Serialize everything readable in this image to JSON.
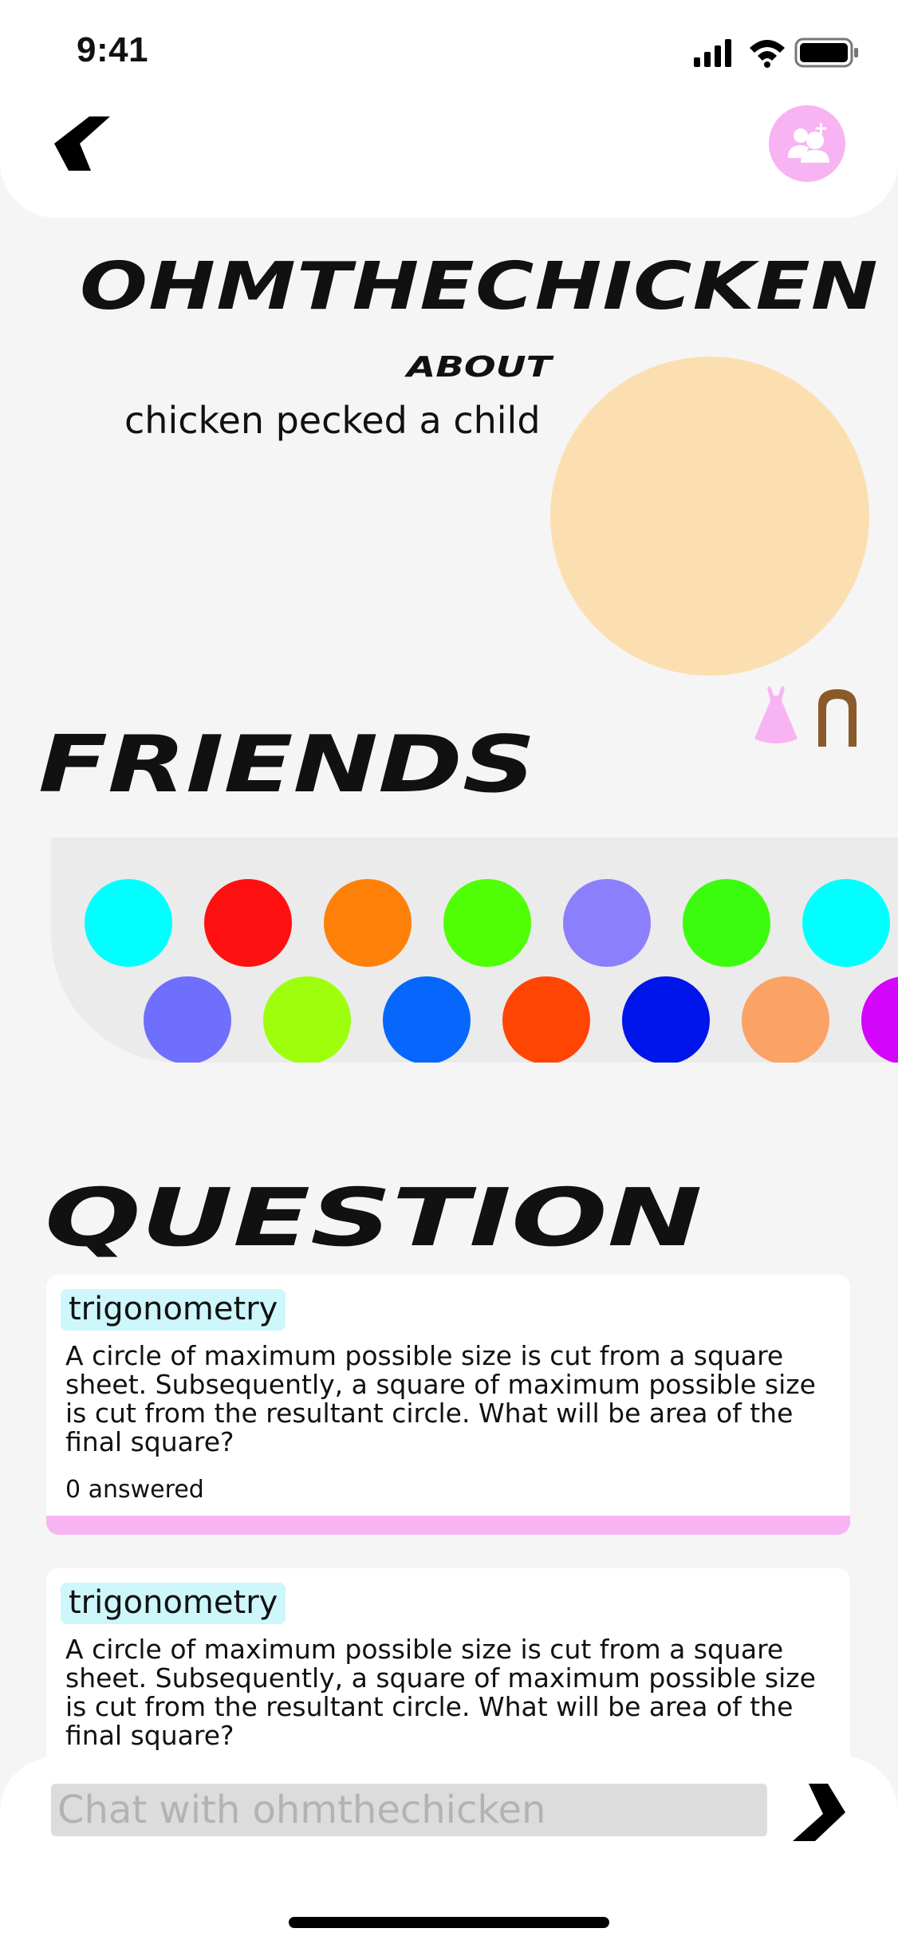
{
  "status_bar": {
    "time": "9:41"
  },
  "header": {
    "back_icon": "chevron-left-icon",
    "add_friend_icon": "add-friend-icon"
  },
  "profile": {
    "username": "OHMTHECHICKEN",
    "about_label": "ABOUT",
    "about_text": "chicken pecked a child",
    "avatar_color": "#fcdfb0",
    "accessories": [
      "dress-icon",
      "hair-icon"
    ]
  },
  "friends": {
    "title": "FRIENDS",
    "row1": [
      "#00ffff",
      "#ff1010",
      "#ff8008",
      "#50ff05",
      "#8c7ffb",
      "#3cfc0d",
      "#00ffff"
    ],
    "row2": [
      "#6f6ffd",
      "#9dff0c",
      "#0767fd",
      "#ff4504",
      "#0015ea",
      "#fba366",
      "#d405fd"
    ]
  },
  "questions": {
    "title": "QUESTION",
    "items": [
      {
        "tag": "trigonometry",
        "text": "A circle of maximum possible size is cut from a square sheet. Subsequently, a square of maximum possible size is cut from the resultant circle. What will be area of the final square?",
        "answered": "0 answered"
      },
      {
        "tag": "trigonometry",
        "text": "A circle of maximum possible size is cut from a square sheet. Subsequently, a square of maximum possible size is cut from the resultant circle. What will be area of the final square?"
      }
    ]
  },
  "chat": {
    "placeholder": "Chat with ohmthechicken",
    "send_icon": "send-icon"
  },
  "colors": {
    "accent_pink": "#f8b3f3",
    "tag_bg": "#cdf7fa"
  }
}
